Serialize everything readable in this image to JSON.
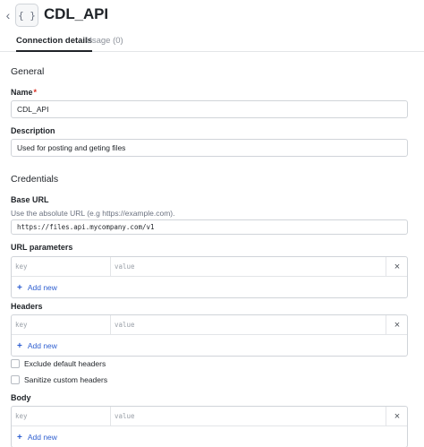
{
  "header": {
    "back_icon": "chevron-left-icon",
    "api_icon_glyph": "{ }",
    "title": "CDL_API"
  },
  "tabs": [
    {
      "label": "Connection details",
      "active": true
    },
    {
      "label": "Usage (0)",
      "active": false
    }
  ],
  "general": {
    "section_title": "General",
    "name": {
      "label": "Name",
      "required_mark": "*",
      "value": "CDL_API"
    },
    "description": {
      "label": "Description",
      "value": "Used for posting and geting files"
    }
  },
  "credentials": {
    "section_title": "Credentials",
    "base_url": {
      "label": "Base URL",
      "hint": "Use the absolute URL (e.g https://example.com).",
      "value": "https://files.api.mycompany.com/v1"
    },
    "url_parameters": {
      "label": "URL parameters",
      "key_placeholder": "key",
      "value_placeholder": "value",
      "remove_glyph": "×",
      "add_label": "Add new",
      "add_glyph": "+"
    },
    "headers": {
      "label": "Headers",
      "key_placeholder": "key",
      "value_placeholder": "value",
      "remove_glyph": "×",
      "add_label": "Add new",
      "add_glyph": "+"
    },
    "exclude_default_headers": {
      "label": "Exclude default headers",
      "checked": false
    },
    "sanitize_custom_headers": {
      "label": "Sanitize custom headers",
      "checked": false
    },
    "body": {
      "label": "Body",
      "key_placeholder": "key",
      "value_placeholder": "value",
      "remove_glyph": "×",
      "add_label": "Add new",
      "add_glyph": "+"
    }
  },
  "colors": {
    "accent_link": "#2f5fd0",
    "required": "#d92d20",
    "border": "#d0d4d9"
  }
}
